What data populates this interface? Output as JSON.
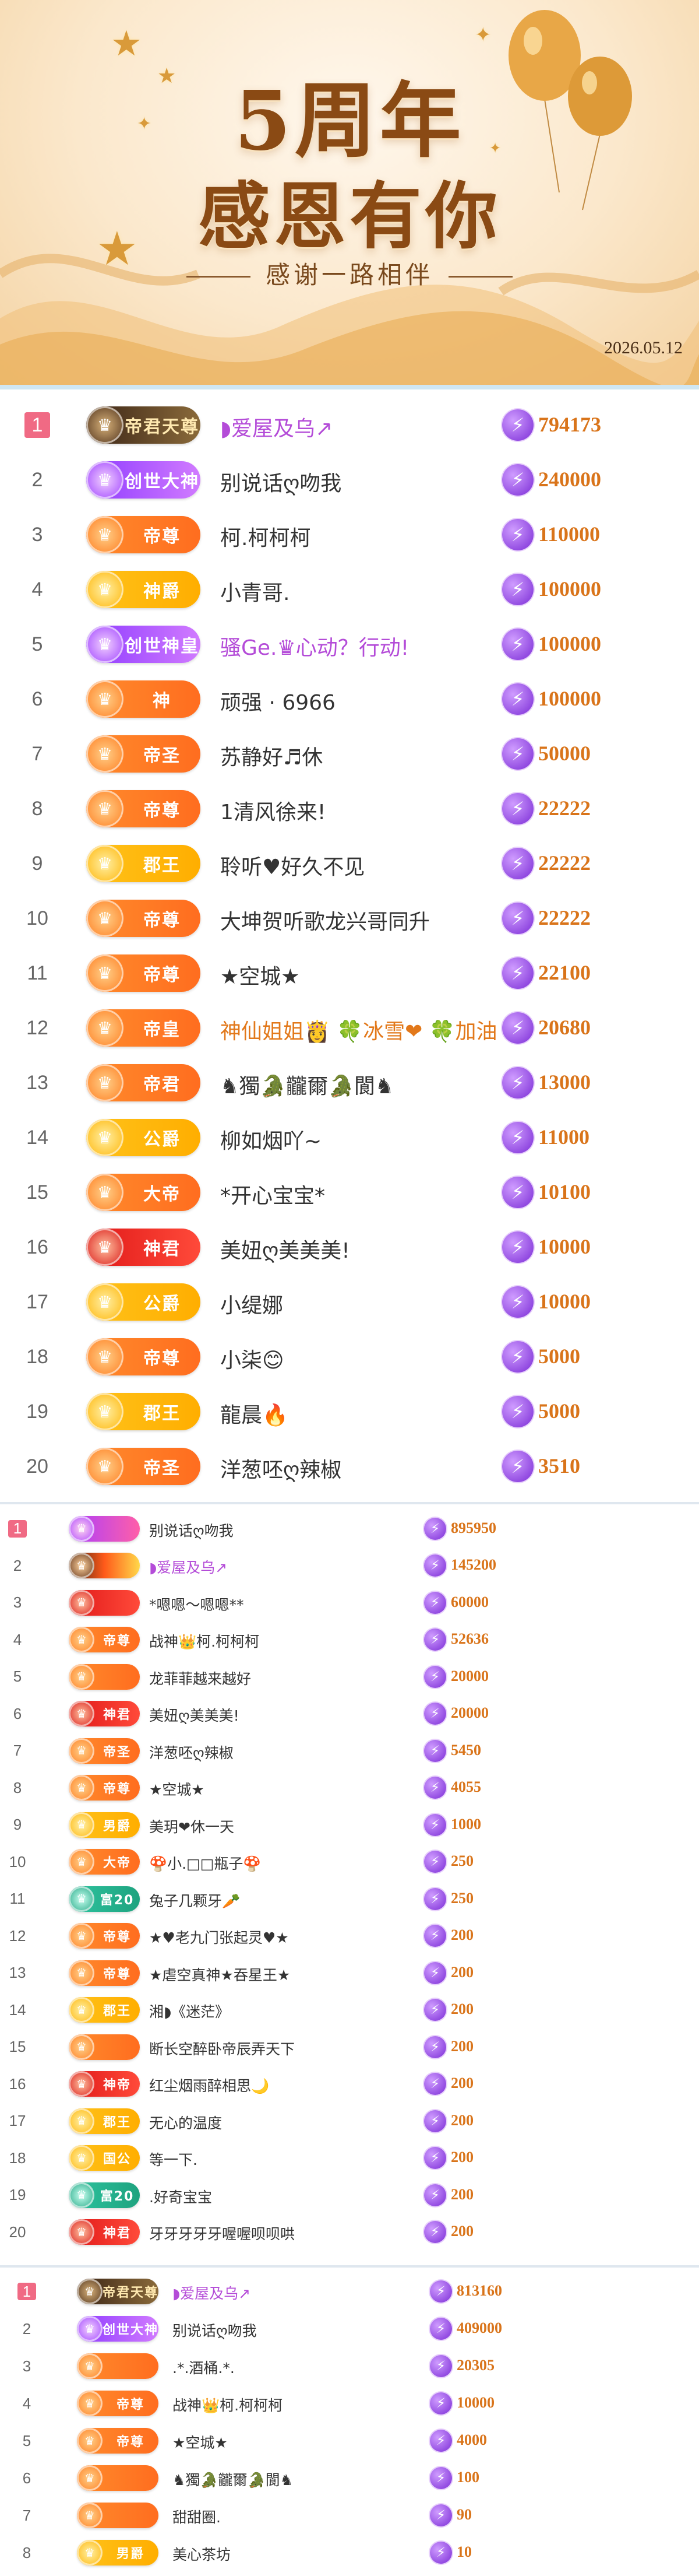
{
  "banner": {
    "title_line1": "5周年",
    "title_line2": "感恩有你",
    "subtitle": "感谢一路相伴",
    "date": "2026.05.12"
  },
  "icons": {
    "currency": "lightning-coin-icon",
    "rank_badge": "emblem-icon"
  },
  "section1": [
    {
      "rank": "1",
      "badge": "帝君天尊",
      "name": "◗爱屋及乌↗",
      "value": "794173"
    },
    {
      "rank": "2",
      "badge": "创世大神",
      "name": "别说话ღ吻我",
      "value": "240000"
    },
    {
      "rank": "3",
      "badge": "帝尊",
      "name": "柯.柯柯柯",
      "value": "110000"
    },
    {
      "rank": "4",
      "badge": "神爵",
      "name": "小青哥.",
      "value": "100000"
    },
    {
      "rank": "5",
      "badge": "创世神皇",
      "name": "骚Ge.♛心动？行动!",
      "value": "100000"
    },
    {
      "rank": "6",
      "badge": "神",
      "name": "顽强 · 6966",
      "value": "100000"
    },
    {
      "rank": "7",
      "badge": "帝圣",
      "name": "苏静好♬休",
      "value": "50000"
    },
    {
      "rank": "8",
      "badge": "帝尊",
      "name": "1清风徐来!",
      "value": "22222"
    },
    {
      "rank": "9",
      "badge": "郡王",
      "name": "聆听♥好久不见",
      "value": "22222"
    },
    {
      "rank": "10",
      "badge": "帝尊",
      "name": "大坤贺听歌龙兴哥同升",
      "value": "22222"
    },
    {
      "rank": "11",
      "badge": "帝尊",
      "name": "★空城★",
      "value": "22100"
    },
    {
      "rank": "12",
      "badge": "帝皇",
      "name": "神仙姐姐👸 🍀冰雪❤ 🍀加油",
      "value": "20680"
    },
    {
      "rank": "13",
      "badge": "帝君",
      "name": "♞獨🐊龖爾🐊閬♞",
      "value": "13000"
    },
    {
      "rank": "14",
      "badge": "公爵",
      "name": "柳如烟吖~",
      "value": "11000"
    },
    {
      "rank": "15",
      "badge": "大帝",
      "name": "*开心宝宝*",
      "value": "10100"
    },
    {
      "rank": "16",
      "badge": "神君",
      "name": "美妞ღ美美美!",
      "value": "10000"
    },
    {
      "rank": "17",
      "badge": "公爵",
      "name": "小缇娜",
      "value": "10000"
    },
    {
      "rank": "18",
      "badge": "帝尊",
      "name": "小柒😊",
      "value": "5000"
    },
    {
      "rank": "19",
      "badge": "郡王",
      "name": "龍晨🔥",
      "value": "5000"
    },
    {
      "rank": "20",
      "badge": "帝圣",
      "name": "洋葱呸ღ辣椒",
      "value": "3510"
    }
  ],
  "section2": [
    {
      "rank": "1",
      "badge": "",
      "name": "别说话ღ吻我",
      "value": "895950"
    },
    {
      "rank": "2",
      "badge": "",
      "name": "◗爱屋及乌↗",
      "value": "145200"
    },
    {
      "rank": "3",
      "badge": "",
      "name": "*嗯嗯～嗯嗯**",
      "value": "60000"
    },
    {
      "rank": "4",
      "badge": "帝尊",
      "name": "战神👑柯.柯柯柯",
      "value": "52636"
    },
    {
      "rank": "5",
      "badge": "",
      "name": "龙菲菲越来越好",
      "value": "20000"
    },
    {
      "rank": "6",
      "badge": "神君",
      "name": "美妞ღ美美美!",
      "value": "20000"
    },
    {
      "rank": "7",
      "badge": "帝圣",
      "name": "洋葱呸ღ辣椒",
      "value": "5450"
    },
    {
      "rank": "8",
      "badge": "帝尊",
      "name": "★空城★",
      "value": "4055"
    },
    {
      "rank": "9",
      "badge": "男爵",
      "name": "美玥❤休一天",
      "value": "1000"
    },
    {
      "rank": "10",
      "badge": "大帝",
      "name": "🍄小.□□瓶子🍄",
      "value": "250"
    },
    {
      "rank": "11",
      "badge": "富20",
      "name": "兔子几颗牙🥕",
      "value": "250"
    },
    {
      "rank": "12",
      "badge": "帝尊",
      "name": "★♥老九门张起灵♥★",
      "value": "200"
    },
    {
      "rank": "13",
      "badge": "帝尊",
      "name": "★虐空真神★吞星王★",
      "value": "200"
    },
    {
      "rank": "14",
      "badge": "郡王",
      "name": "湘◗《迷茫》",
      "value": "200"
    },
    {
      "rank": "15",
      "badge": "",
      "name": "断长空醉卧帝辰弄天下",
      "value": "200"
    },
    {
      "rank": "16",
      "badge": "神帝",
      "name": "红尘烟雨醉相思🌙",
      "value": "200"
    },
    {
      "rank": "17",
      "badge": "郡王",
      "name": "无心的温度",
      "value": "200"
    },
    {
      "rank": "18",
      "badge": "国公",
      "name": "等一下.",
      "value": "200"
    },
    {
      "rank": "19",
      "badge": "富20",
      "name": ".好奇宝宝",
      "value": "200"
    },
    {
      "rank": "20",
      "badge": "神君",
      "name": "牙牙牙牙牙喔喔呗呗哄",
      "value": "200"
    }
  ],
  "section3": [
    {
      "rank": "1",
      "badge": "帝君天尊",
      "name": "◗爱屋及乌↗",
      "value": "813160"
    },
    {
      "rank": "2",
      "badge": "创世大神",
      "name": "别说话ღ吻我",
      "value": "409000"
    },
    {
      "rank": "3",
      "badge": "",
      "name": ".*.酒桶.*.",
      "value": "20305"
    },
    {
      "rank": "4",
      "badge": "帝尊",
      "name": "战神👑柯.柯柯柯",
      "value": "10000"
    },
    {
      "rank": "5",
      "badge": "帝尊",
      "name": "★空城★",
      "value": "4000"
    },
    {
      "rank": "6",
      "badge": "",
      "name": "♞獨🐊龖爾🐊閬♞",
      "value": "100"
    },
    {
      "rank": "7",
      "badge": "",
      "name": "甜甜圈.",
      "value": "90"
    },
    {
      "rank": "8",
      "badge": "男爵",
      "name": "美心茶坊",
      "value": "10"
    }
  ]
}
